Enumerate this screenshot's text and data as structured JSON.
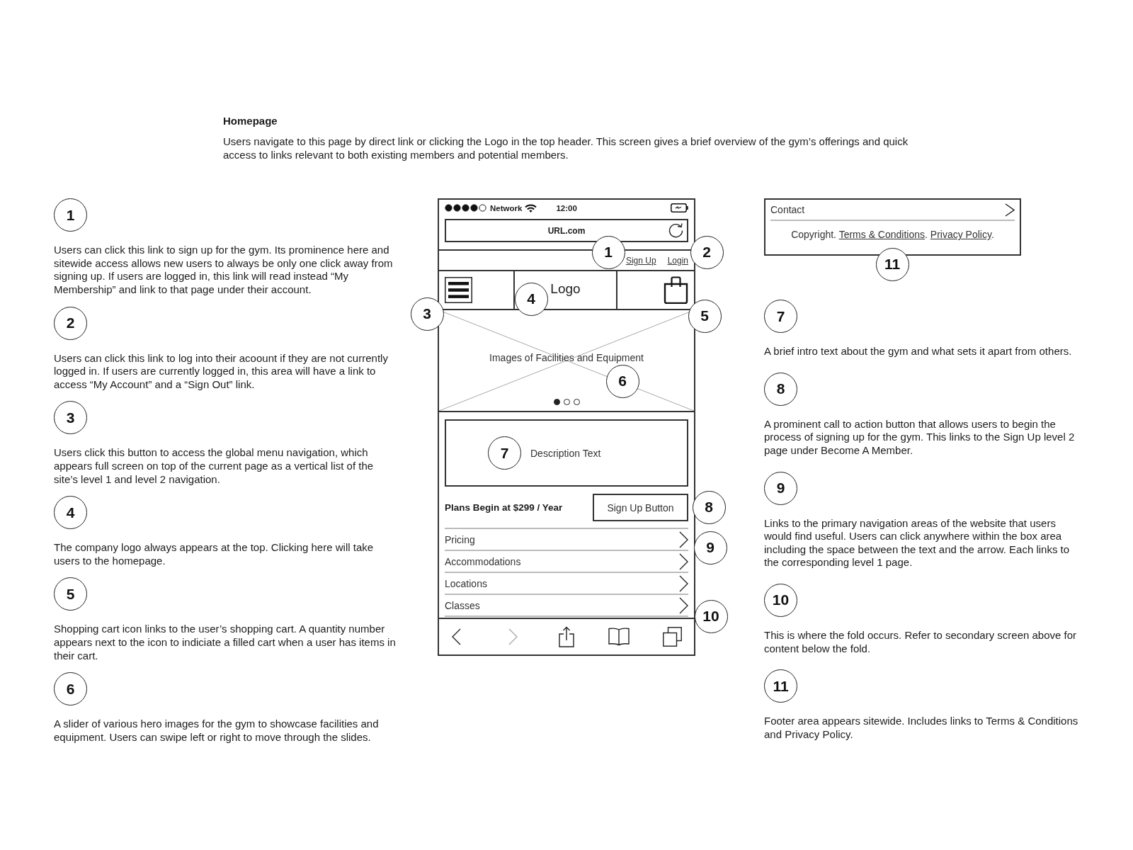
{
  "page": {
    "title": "Homepage",
    "intro": "Users navigate to this page by direct link or clicking the Logo in the top header. This screen gives a brief overview of the gym’s offerings and quick access to links relevant to both existing members and potential members."
  },
  "phone": {
    "network": "Network",
    "time": "12:00",
    "url": "URL.com",
    "account_links": [
      "Sign Up",
      "Login"
    ],
    "logo": "Logo",
    "hero": {
      "caption": "Images of Facilities and Equipment",
      "slides": [
        {
          "selected": true
        },
        {
          "selected": false
        },
        {
          "selected": false
        }
      ]
    },
    "description": {
      "callout": "7",
      "text": "Description Text"
    },
    "plans": "Plans Begin at $299 / Year",
    "signup_button": "Sign Up Button",
    "nav_links": [
      "Pricing",
      "Accommodations",
      "Locations",
      "Classes"
    ],
    "nav_buttons": [
      {
        "disabled": false
      },
      {
        "disabled": true
      }
    ],
    "callouts": [
      "1",
      "2",
      "3",
      "4",
      "5",
      "6",
      "8",
      "9",
      "10"
    ]
  },
  "footer": {
    "contact": "Contact",
    "segments": [
      {
        "kind": "text",
        "text": "Copyright. "
      },
      {
        "kind": "link",
        "text": "Terms & Conditions"
      },
      {
        "kind": "text",
        "text": ". "
      },
      {
        "kind": "link",
        "text": "Privacy Policy"
      },
      {
        "kind": "text",
        "text": "."
      }
    ],
    "callout": "11"
  },
  "left_notes": [
    {
      "number": "1",
      "text": "Users can click this link to sign up for the gym. Its prominence here and sitewide access allows new users to always be only one click away from signing up. If users are logged in, this link will read instead “My Membership” and link to that page under their account."
    },
    {
      "number": "2",
      "text": "Users can click this link to log into their acoount if they are not currently logged in. If users are currently logged in, this area will have a link to access “My Account” and a “Sign Out” link."
    },
    {
      "number": "3",
      "text": "Users click this button to access the global menu navigation, which appears full screen on top of the current page as a vertical list of the site’s level 1 and level 2 navigation."
    },
    {
      "number": "4",
      "text": "The company logo always appears at the top. Clicking here will take users to the homepage."
    },
    {
      "number": "5",
      "text": "Shopping cart icon links to the user’s shopping cart. A quantity number appears next to the icon to indiciate a filled cart when a user has items in their cart."
    },
    {
      "number": "6",
      "text": "A slider of various hero images for the gym to showcase facilities and equipment. Users can swipe left or right to move through the slides."
    }
  ],
  "right_notes": [
    {
      "number": "7",
      "text": "A brief intro text about the gym and what sets it apart from others."
    },
    {
      "number": "8",
      "text": "A prominent call to action button that allows users to begin the process of signing up for the gym. This links to the Sign Up level 2 page under Become A Member."
    },
    {
      "number": "9",
      "text": "Links to the primary navigation areas of the website that users would find useful. Users can click anywhere within the box area including the space between the text and the arrow. Each links to the corresponding level 1 page."
    },
    {
      "number": "10",
      "text": "This is where the fold occurs. Refer to secondary screen above for content below the fold."
    },
    {
      "number": "11",
      "text": "Footer area appears sitewide. Includes links to Terms & Conditions and Privacy Policy."
    }
  ]
}
